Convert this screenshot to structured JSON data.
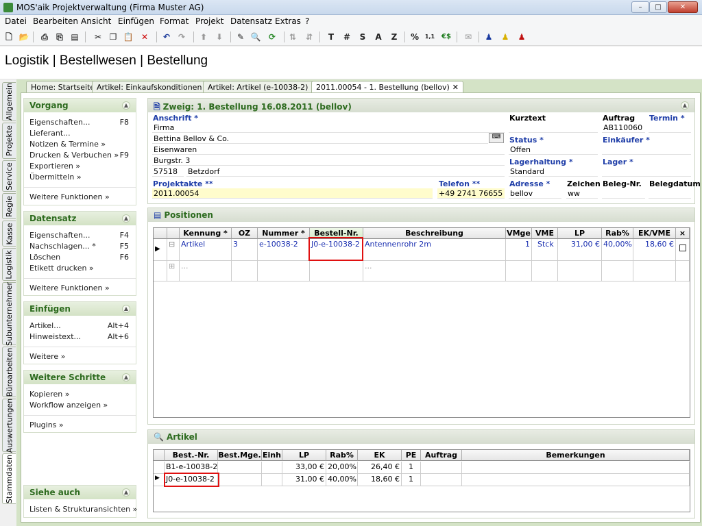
{
  "window": {
    "title": "MOS'aik Projektverwaltung (Firma Muster AG)",
    "minimize": "–",
    "maximize": "□",
    "close": "✕"
  },
  "menu": [
    "Datei",
    "Bearbeiten",
    "Ansicht",
    "Einfügen",
    "Format",
    "Projekt",
    "Datensatz",
    "Extras",
    "?"
  ],
  "toolbar_icons": [
    "new-document-icon",
    "open-folder-icon",
    "cut-icon",
    "copy-icon",
    "paste-icon",
    "delete-icon",
    "undo-icon",
    "redo-icon",
    "arrow-up-icon",
    "arrow-down-icon",
    "edit-icon",
    "search-icon",
    "refresh-icon",
    "sort-asc-icon",
    "sort-desc-icon",
    "T",
    "#",
    "S",
    "A",
    "Z",
    "%",
    "1,1",
    "€$"
  ],
  "page_title": "Logistik | Bestellwesen | Bestellung",
  "vertical_tabs": [
    "Allgemein",
    "Projekte",
    "Service",
    "Regie",
    "Kasse",
    "Logistik",
    "Subunternehmer",
    "Büroarbeiten",
    "Auswertungen",
    "Stammdaten"
  ],
  "doc_tabs": [
    {
      "label": "Home: Startseite"
    },
    {
      "label": "Artikel: Einkaufskonditionen"
    },
    {
      "label": "Artikel: Artikel (e-10038-2)"
    },
    {
      "label": "2011.00054 - 1. Bestellung (bellov)"
    }
  ],
  "left_panels": {
    "vorgang": {
      "title": "Vorgang",
      "items": [
        {
          "label": "Eigenschaften...",
          "key": "F8"
        },
        {
          "label": "Lieferant...",
          "key": ""
        },
        {
          "label": "Notizen & Termine »",
          "key": ""
        },
        {
          "label": "Drucken & Verbuchen »",
          "key": "F9"
        },
        {
          "label": "Exportieren »",
          "key": ""
        },
        {
          "label": "Übermitteln »",
          "key": ""
        }
      ],
      "more": "Weitere Funktionen »"
    },
    "datensatz": {
      "title": "Datensatz",
      "items": [
        {
          "label": "Eigenschaften...",
          "key": "F4"
        },
        {
          "label": "Nachschlagen... *",
          "key": "F5"
        },
        {
          "label": "Löschen",
          "key": "F6"
        },
        {
          "label": "Etikett drucken »",
          "key": ""
        }
      ],
      "more": "Weitere Funktionen »"
    },
    "einfuegen": {
      "title": "Einfügen",
      "items": [
        {
          "label": "Artikel...",
          "key": "Alt+4"
        },
        {
          "label": "Hinweistext...",
          "key": "Alt+6"
        }
      ],
      "more": "Weitere »"
    },
    "weitere": {
      "title": "Weitere Schritte",
      "items": [
        {
          "label": "Kopieren »",
          "key": ""
        },
        {
          "label": "Workflow anzeigen »",
          "key": ""
        }
      ],
      "more": "Plugins »"
    },
    "siehe": {
      "title": "Siehe auch",
      "items": [
        {
          "label": "Listen & Strukturansichten »",
          "key": ""
        }
      ]
    }
  },
  "branch": {
    "title": "Zweig: 1. Bestellung 16.08.2011 (bellov)",
    "anschrift_label": "Anschrift *",
    "address": [
      "Firma",
      "Bettina Bellov & Co.",
      "Eisenwaren",
      "Burgstr. 3"
    ],
    "plz": "57518",
    "ort": "Betzdorf",
    "projektakte_label": "Projektakte **",
    "projektakte": "2011.00054",
    "telefon_label": "Telefon **",
    "telefon": "+49 2741 76655",
    "kurztext_label": "Kurztext",
    "kurztext": "",
    "auftrag_label": "Auftrag",
    "auftrag": "AB110060",
    "termin_label": "Termin *",
    "termin": "",
    "status_label": "Status *",
    "status": "Offen",
    "einkaeufer_label": "Einkäufer *",
    "einkaeufer": "",
    "lagerhaltung_label": "Lagerhaltung *",
    "lagerhaltung": "Standard",
    "lager_label": "Lager *",
    "lager": "",
    "adresse_label": "Adresse *",
    "adresse": "bellov",
    "zeichen_label": "Zeichen",
    "zeichen": "ww",
    "belegnr_label": "Beleg-Nr.",
    "belegnr": "",
    "belegdatum_label": "Belegdatum",
    "belegdatum": ""
  },
  "positionen": {
    "title": "Positionen",
    "columns": [
      "Kennung *",
      "OZ",
      "Nummer *",
      "Bestell-Nr.",
      "Beschreibung",
      "VMge",
      "VME",
      "LP",
      "Rab%",
      "EK/VME",
      "×"
    ],
    "row": {
      "kennung": "Artikel",
      "oz": "3",
      "nummer": "e-10038-2",
      "bestellnr": "J0-e-10038-2",
      "beschreibung": "Antennenrohr 2m",
      "vmge": "1",
      "vme": "Stck",
      "lp": "31,00 €",
      "rab": "40,00%",
      "ek": "18,60 €"
    },
    "empty_row": {
      "kennung": "...",
      "beschreibung": "..."
    }
  },
  "artikel": {
    "title": "Artikel",
    "columns": [
      "Best.-Nr.",
      "Best.Mge.",
      "Einh",
      "LP",
      "Rab%",
      "EK",
      "PE",
      "Auftrag",
      "Bemerkungen"
    ],
    "rows": [
      {
        "nr": "B1-e-10038-2",
        "mge": "",
        "einh": "",
        "lp": "33,00 €",
        "rab": "20,00%",
        "ek": "26,40 €",
        "pe": "1",
        "auftrag": "",
        "bem": ""
      },
      {
        "nr": "J0-e-10038-2",
        "mge": "",
        "einh": "",
        "lp": "31,00 €",
        "rab": "40,00%",
        "ek": "18,60 €",
        "pe": "1",
        "auftrag": "",
        "bem": ""
      }
    ]
  }
}
